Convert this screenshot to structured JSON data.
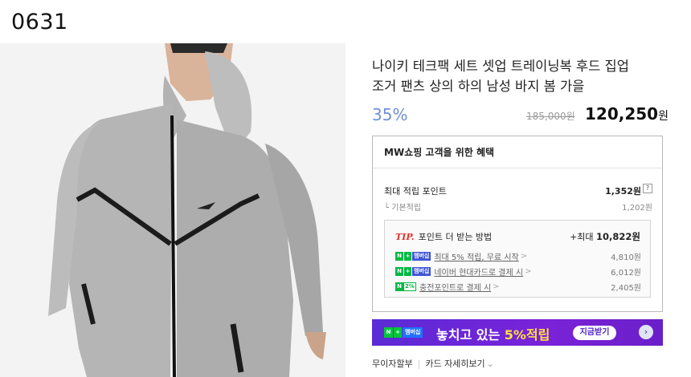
{
  "code_label": "0631",
  "product": {
    "title_line1": "나이키 테크팩 세트 셋업 트레이닝복 후드 집업",
    "title_line2": "조거 팬츠 상의 하의 남성 바지 봄 가을",
    "discount": "35%",
    "original_price": "185,000원",
    "sale_price": "120,250",
    "sale_currency": "원",
    "image": "man-in-grey-nike-tech-fleece-hoodie"
  },
  "benefits": {
    "heading": "MW쇼핑 고객을 위한 혜택",
    "max_points_label": "최대 적립 포인트",
    "max_points_value": "1,352원",
    "help": "?",
    "basic_label": "기본적립",
    "basic_value": "1,202원",
    "tip": {
      "tag": "TIP.",
      "heading": "포인트 더 받는 방법",
      "max_prefix": "+최대 ",
      "max_value": "10,822원",
      "rows": [
        {
          "badge_n": "N",
          "badge_plus": "+",
          "badge_member": "멤버십",
          "text": "최대 5% 적립, 무료 시작",
          "amount": "4,810원"
        },
        {
          "badge_n": "N",
          "badge_plus": "+",
          "badge_member": "멤버십",
          "text": "네이버 현대카드로 결제 시",
          "amount": "6,012원"
        },
        {
          "badge_n": "N",
          "badge_pct": "2%",
          "text": "충전포인트로 결제 시",
          "amount": "2,405원"
        }
      ],
      "arrow": ">"
    }
  },
  "banner": {
    "badge_n": "N",
    "badge_plus": "+",
    "badge_member": "멤버십",
    "text_main": "놓치고 있는 ",
    "text_highlight": "5%적립",
    "button_label": "지금받기",
    "arrow": "›"
  },
  "footer": {
    "link1": "무이자할부",
    "link2": "카드 자세히보기",
    "chevron": "⌄"
  },
  "colors": {
    "discount": "#6f8fd6",
    "tip_tag": "#e0322a",
    "naver_green": "#00b843",
    "banner_purple": "#6a24d6",
    "banner_highlight": "#ffe23a"
  }
}
